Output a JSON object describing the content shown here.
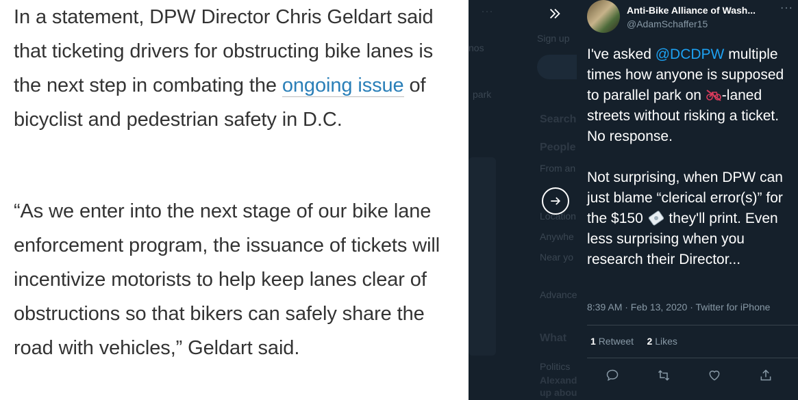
{
  "article": {
    "p1_before_link": "In a statement, DPW Director Chris Geldart said that ticketing drivers for obstructing bike lanes is the next step in combating the ",
    "p1_link": "ongoing issue",
    "p1_after_link": " of bicyclist and pedestrian safety in D.C.",
    "p2": "“As we enter into the next stage of our bike lane enforcement program, the issuance of tickets will incentivize motorists to help keep lanes clear of obstructions so that bikers can safely share the road with vehicles,” Geldart said."
  },
  "background": {
    "labels": [
      "Sign up",
      "nos",
      "park",
      "Search",
      "People",
      "From an",
      "Location",
      "Anywhe",
      "Near yo",
      "Advance",
      "What",
      "Politics",
      "Alexand",
      "up abou"
    ]
  },
  "tweet": {
    "author_name": "Anti-Bike Alliance of Wash...",
    "handle": "@AdamSchaffer15",
    "text_1": "I've asked ",
    "mention": "@DCDPW",
    "text_2": " multiple times how anyone is supposed to parallel park on ",
    "text_3": "-laned streets without risking a ticket. No response.",
    "text_4": "Not surprising, when DPW can just blame “clerical error(s)” for the $150 ",
    "text_5": " they'll print. Even less surprising when you research their Director...",
    "emoji_1": "bicycle-prohibited",
    "emoji_2": "money-with-wings",
    "timestamp": "8:39 AM · Feb 13, 2020 · Twitter for iPhone",
    "retweets_count": "1",
    "retweets_label": "Retweet",
    "likes_count": "2",
    "likes_label": "Likes"
  },
  "colors": {
    "panel_bg": "#15202b",
    "accent": "#1da1f2",
    "link": "#2a7fb8",
    "muted": "#8899a6"
  }
}
